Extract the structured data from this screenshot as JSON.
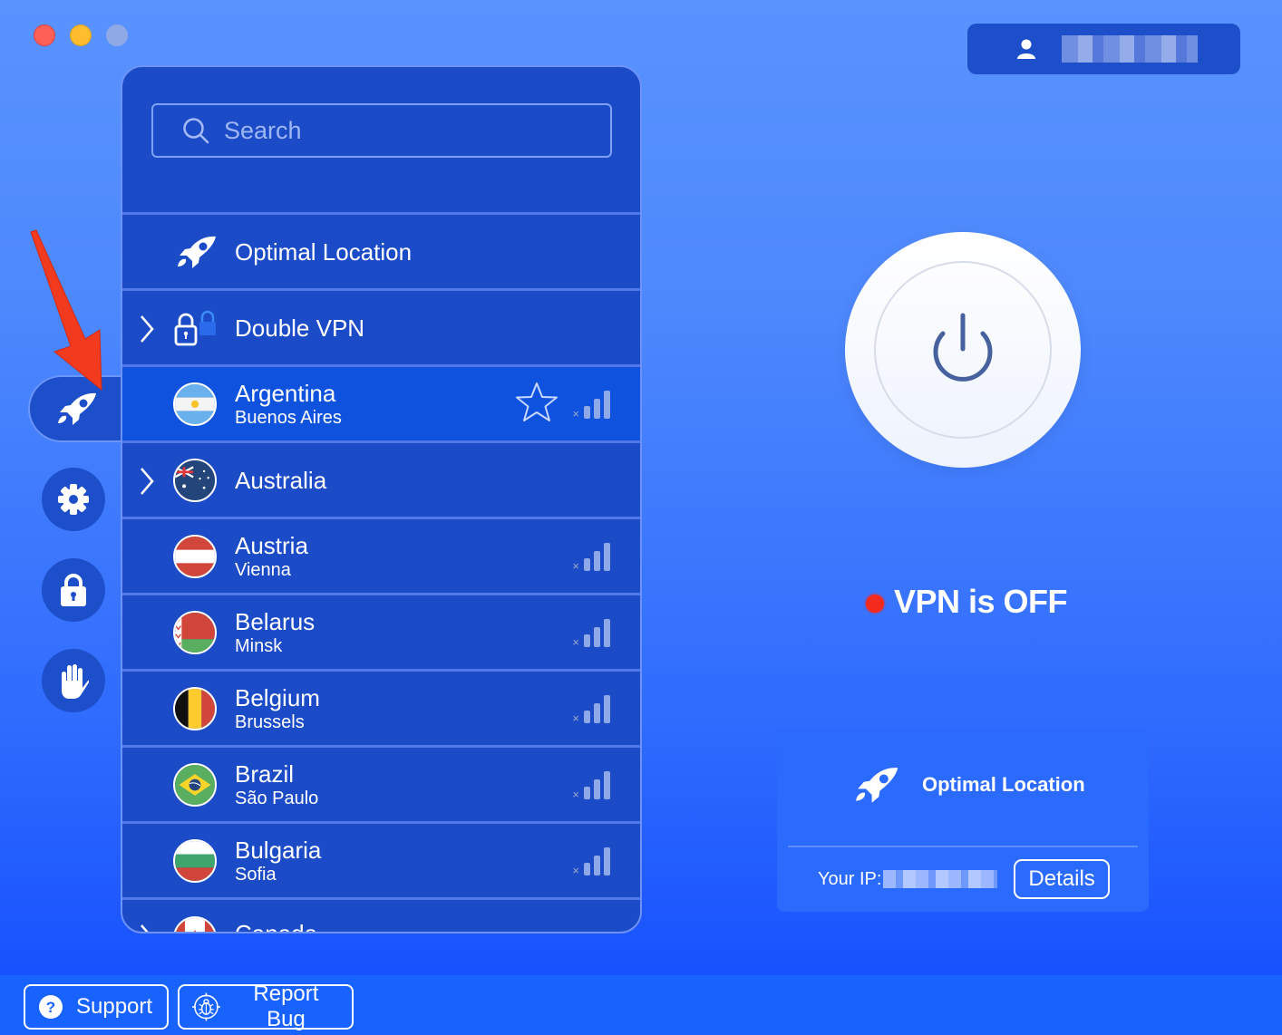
{
  "window": {
    "controls": [
      "close",
      "minimize",
      "maximize"
    ]
  },
  "account": {
    "icon": "user-icon",
    "name_masked": true
  },
  "sidebar": {
    "items": [
      {
        "name": "locations",
        "icon": "rocket-icon",
        "active": true
      },
      {
        "name": "settings",
        "icon": "gear-icon",
        "active": false
      },
      {
        "name": "security",
        "icon": "lock-icon",
        "active": false
      },
      {
        "name": "adblock",
        "icon": "hand-icon",
        "active": false
      }
    ]
  },
  "annotation": {
    "type": "red-arrow",
    "points_to": "locations"
  },
  "search": {
    "placeholder": "Search",
    "value": ""
  },
  "locations": {
    "special": [
      {
        "title": "Optimal Location",
        "icon": "rocket-icon",
        "expandable": false
      },
      {
        "title": "Double VPN",
        "icon": "double-lock-icon",
        "expandable": true
      }
    ],
    "countries": [
      {
        "country": "Argentina",
        "city": "Buenos Aires",
        "flag": "argentina",
        "expandable": false,
        "selected": true,
        "favorite_visible": true,
        "signal_bars": 3
      },
      {
        "country": "Australia",
        "city": "",
        "flag": "australia",
        "expandable": true,
        "selected": false,
        "signal_bars": 0
      },
      {
        "country": "Austria",
        "city": "Vienna",
        "flag": "austria",
        "expandable": false,
        "selected": false,
        "signal_bars": 3
      },
      {
        "country": "Belarus",
        "city": "Minsk",
        "flag": "belarus",
        "expandable": false,
        "selected": false,
        "signal_bars": 3
      },
      {
        "country": "Belgium",
        "city": "Brussels",
        "flag": "belgium",
        "expandable": false,
        "selected": false,
        "signal_bars": 3
      },
      {
        "country": "Brazil",
        "city": "São Paulo",
        "flag": "brazil",
        "expandable": false,
        "selected": false,
        "signal_bars": 3
      },
      {
        "country": "Bulgaria",
        "city": "Sofia",
        "flag": "bulgaria",
        "expandable": false,
        "selected": false,
        "signal_bars": 3
      },
      {
        "country": "Canada",
        "city": "",
        "flag": "canada",
        "expandable": true,
        "selected": false,
        "signal_bars": 0
      }
    ]
  },
  "status": {
    "text": "VPN is OFF",
    "color": "#f42a1f",
    "connected": false
  },
  "connection_card": {
    "location": "Optimal Location",
    "ip_label": "Your IP:",
    "ip_masked": true,
    "details_label": "Details"
  },
  "footer": {
    "support_label": "Support",
    "report_bug_label": "Report Bug"
  },
  "colors": {
    "panel": "#1c4bc8",
    "accent_bg": "#4d88fd",
    "selected_row": "#0f52de"
  }
}
